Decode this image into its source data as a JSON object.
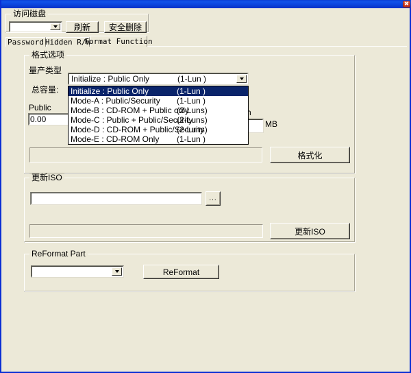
{
  "window": {
    "close_label": "✖"
  },
  "access_disk": {
    "group_title": "访问磁盘",
    "drive_value": "",
    "refresh_label": "刷新",
    "safe_remove_label": "安全删除"
  },
  "tabs": [
    {
      "label": "Password",
      "selected": false
    },
    {
      "label": "Hidden R/W",
      "selected": false
    },
    {
      "label": "Format Function",
      "selected": true
    }
  ],
  "format_options": {
    "group_title": "格式选项",
    "type_label": "量产类型",
    "capacity_label": "总容量:",
    "public_label": "Public",
    "public_value": "0.00",
    "occluded_label_fragment": "n",
    "occluded_field_value": "",
    "unit_label": "MB",
    "selected_type": {
      "name": "Initialize : Public Only",
      "luns": "(1-Lun )"
    },
    "type_options": [
      {
        "name": "Initialize : Public Only",
        "luns": "(1-Lun )",
        "selected": true
      },
      {
        "name": "Mode-A : Public/Security",
        "luns": "(1-Lun )",
        "selected": false
      },
      {
        "name": "Mode-B : CD-ROM + Public only",
        "luns": "(2-Luns)",
        "selected": false
      },
      {
        "name": "Mode-C : Public + Public/Security",
        "luns": "(2-Luns)",
        "selected": false
      },
      {
        "name": "Mode-D : CD-ROM + Public/Security",
        "luns": "(2-Luns)",
        "selected": false
      },
      {
        "name": "Mode-E : CD-ROM Only",
        "luns": "(1-Lun )",
        "selected": false
      }
    ],
    "progress_value": "",
    "format_button_label": "格式化"
  },
  "update_iso": {
    "group_title": "更新ISO",
    "path_value": "",
    "browse_label": "...",
    "progress_value": "",
    "update_button_label": "更新ISO"
  },
  "reformat_part": {
    "group_title": "ReFormat Part",
    "part_value": "",
    "reformat_button_label": "ReFormat"
  },
  "colors": {
    "face": "#ece9d8",
    "titlebar": "#0c46e0",
    "frame_border": "#0a2fd4",
    "selection": "#0a246a",
    "close_button": "#d8452a"
  }
}
